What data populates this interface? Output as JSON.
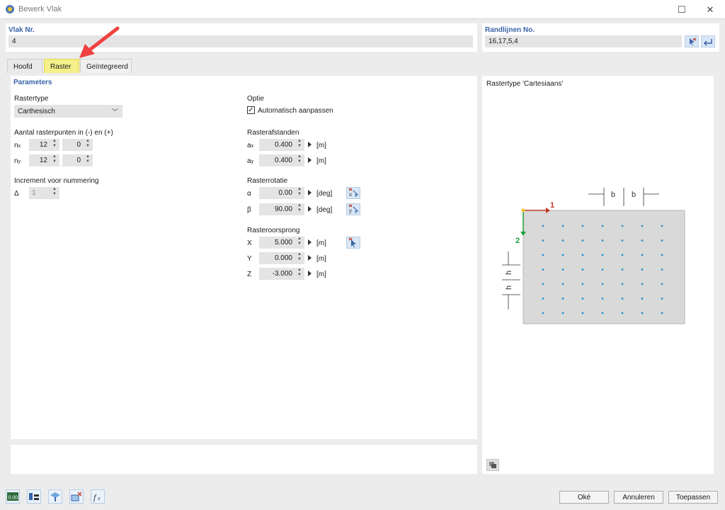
{
  "window": {
    "title": "Bewerk Vlak",
    "maximize_glyph": "☐",
    "close_glyph": "✕"
  },
  "header": {
    "vlak_label": "Vlak Nr.",
    "vlak_value": "4",
    "randlijnen_label": "Randlijnen No.",
    "randlijnen_value": "16,17,5,4"
  },
  "tabs": [
    {
      "label": "Hoofd"
    },
    {
      "label": "Raster",
      "active": true
    },
    {
      "label": "Geïntegreerd"
    }
  ],
  "params": {
    "section_title": "Parameters",
    "rastertype_label": "Rastertype",
    "rastertype_value": "Carthesisch",
    "aantal_label": "Aantal rasterpunten in (-) en (+)",
    "nx_label": "n",
    "nx_sub": "x",
    "nx_minus": "12",
    "nx_plus": "0",
    "ny_label": "n",
    "ny_sub": "y",
    "ny_minus": "12",
    "ny_plus": "0",
    "increment_label": "Increment voor nummering",
    "delta_label": "Δ",
    "delta_value": "1"
  },
  "options": {
    "optie_label": "Optie",
    "auto_label": "Automatisch aanpassen",
    "auto_checked": true,
    "afstanden_label": "Rasterafstanden",
    "ax_label": "a",
    "ax_sub": "x",
    "ax_value": "0.400",
    "ay_label": "a",
    "ay_sub": "y",
    "ay_value": "0.400",
    "unit_m": "[m]",
    "rotatie_label": "Rasterrotatie",
    "alpha_label": "α",
    "alpha_value": "0.00",
    "beta_label": "β",
    "beta_value": "90.00",
    "unit_deg": "[deg]",
    "oorsprong_label": "Rasteroorsprong",
    "x_label": "X",
    "x_value": "5.000",
    "y_label": "Y",
    "y_value": "0.000",
    "z_label": "Z",
    "z_value": "-3.000"
  },
  "preview": {
    "title": "Rastertype 'Cartesiaans'",
    "axis1": "1",
    "axis2": "2",
    "b_label": "b",
    "h_label": "h",
    "axis1_color": "#c0392b",
    "axis2_color": "#1e9e3a",
    "dot_color": "#2a90d0"
  },
  "footer": {
    "ok": "Oké",
    "cancel": "Annuleren",
    "apply": "Toepassen",
    "icon1_text": "0.00"
  },
  "colors": {
    "accent": "#3a63a8",
    "highlight": "#f5f08a",
    "arrow": "#f04040"
  }
}
